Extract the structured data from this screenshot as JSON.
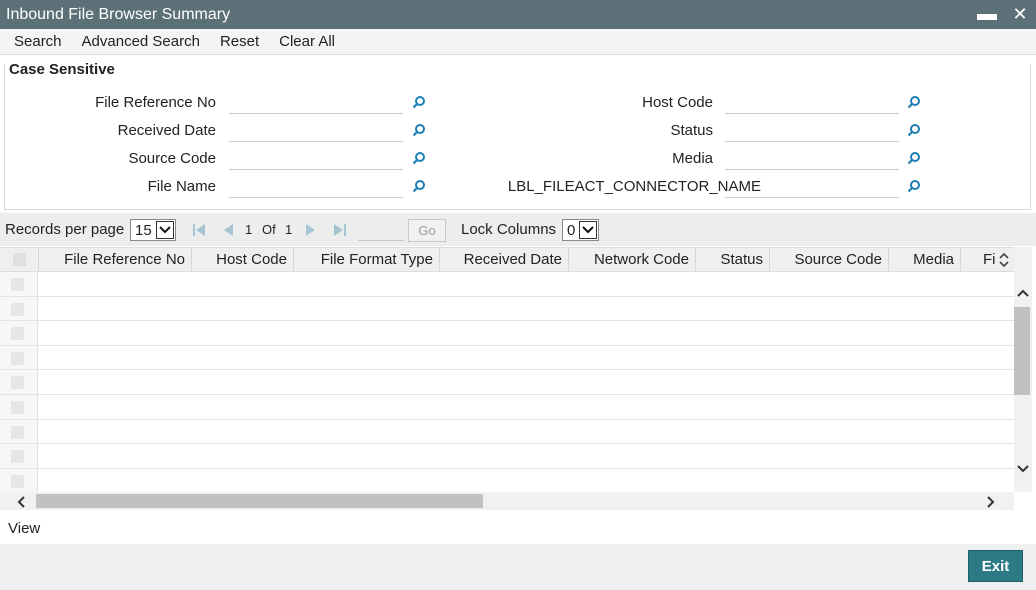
{
  "window": {
    "title": "Inbound File Browser Summary",
    "minimize": "▬",
    "close": "✕"
  },
  "menu": {
    "items": [
      "Search",
      "Advanced Search",
      "Reset",
      "Clear All"
    ]
  },
  "criteria": {
    "legend": "Case Sensitive",
    "left": [
      {
        "label": "File Reference No",
        "value": ""
      },
      {
        "label": "Received Date",
        "value": ""
      },
      {
        "label": "Source Code",
        "value": ""
      },
      {
        "label": "File Name",
        "value": ""
      }
    ],
    "right": [
      {
        "label": "Host Code",
        "value": ""
      },
      {
        "label": "Status",
        "value": ""
      },
      {
        "label": "Media",
        "value": ""
      },
      {
        "label": "LBL_FILEACT_CONNECTOR_NAME",
        "value": ""
      }
    ],
    "icon": "search-lookup-icon"
  },
  "pager": {
    "records_label": "Records per page",
    "records_value": "15",
    "current_page": "1",
    "of_label": "Of",
    "total_pages": "1",
    "go_label": "Go",
    "lock_label": "Lock Columns",
    "lock_value": "0"
  },
  "grid": {
    "columns": [
      "File Reference No",
      "Host Code",
      "File Format Type",
      "Received Date",
      "Network Code",
      "Status",
      "Source Code",
      "Media",
      "Fi"
    ],
    "row_count_visible": 9
  },
  "footer": {
    "view_label": "View",
    "exit_label": "Exit"
  },
  "colors": {
    "titlebar": "#5b7177",
    "accent": "#2b7a85",
    "lookup_icon": "#1f7fb5"
  }
}
